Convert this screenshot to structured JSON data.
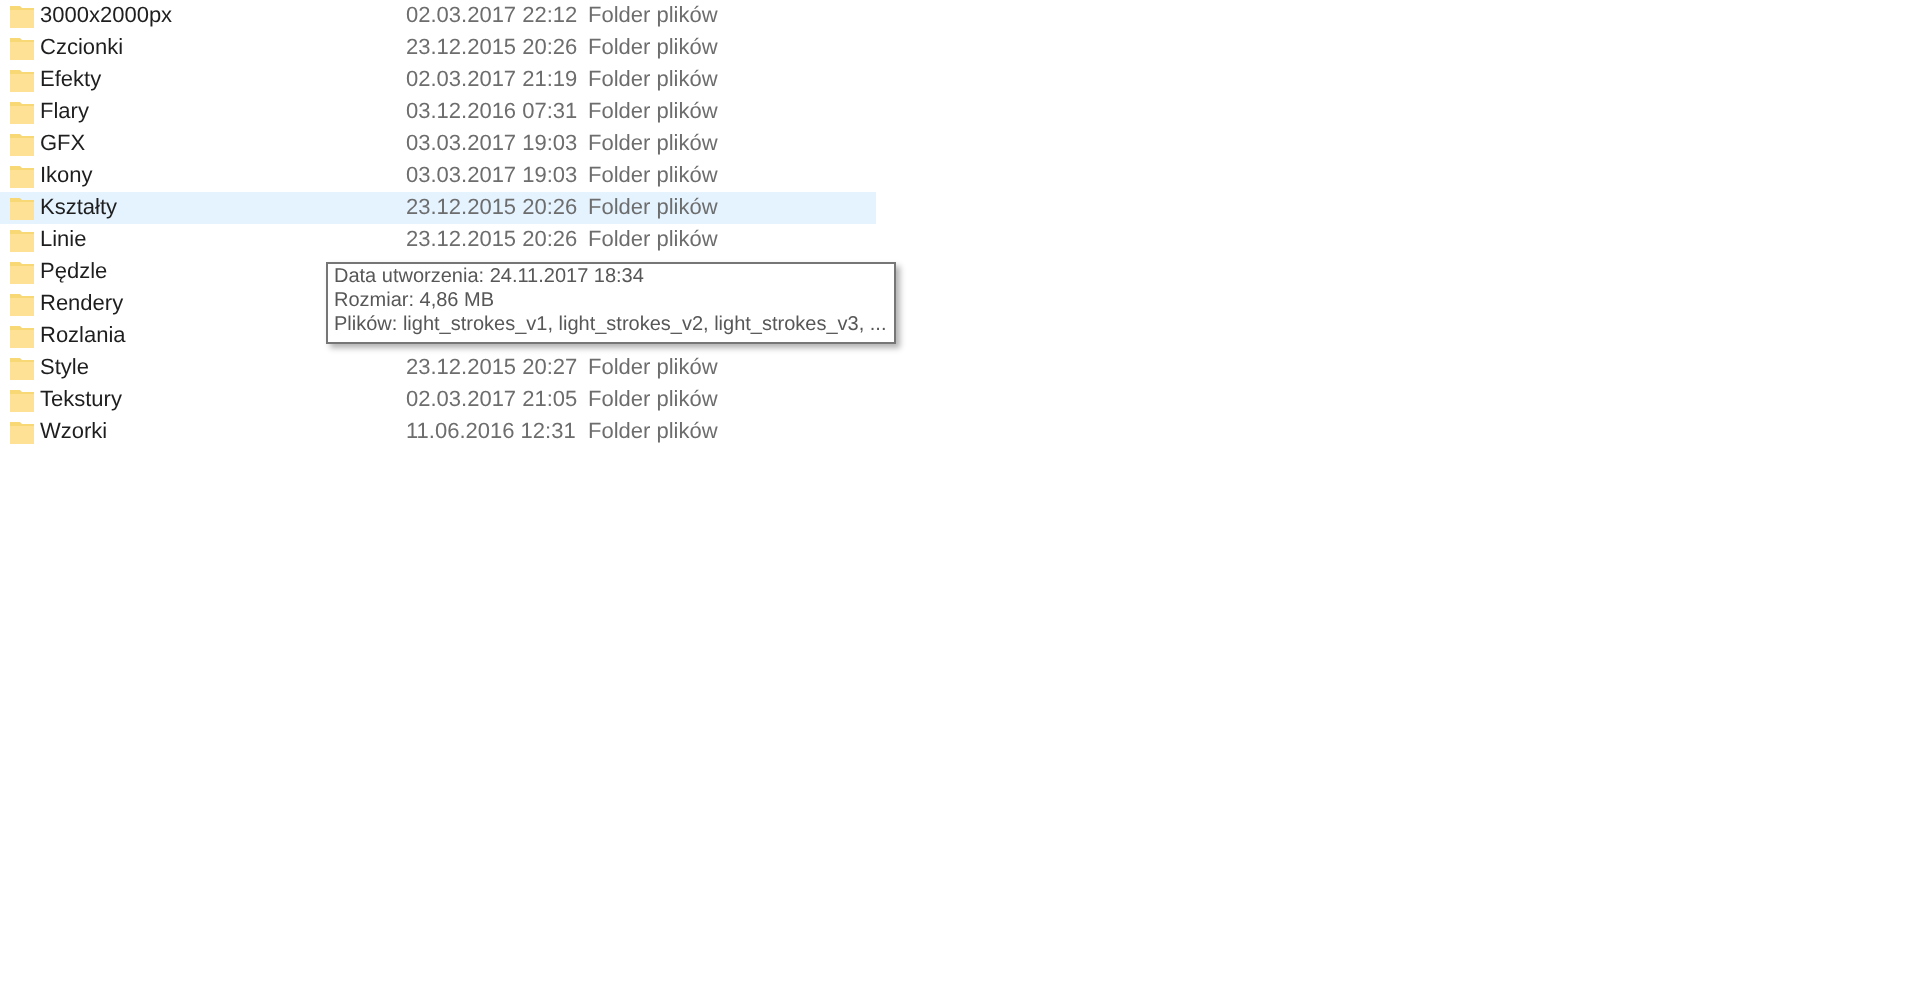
{
  "files": [
    {
      "name": "3000x2000px",
      "modified": "02.03.2017 22:12",
      "type": "Folder plików",
      "selected": false
    },
    {
      "name": "Czcionki",
      "modified": "23.12.2015 20:26",
      "type": "Folder plików",
      "selected": false
    },
    {
      "name": "Efekty",
      "modified": "02.03.2017 21:19",
      "type": "Folder plików",
      "selected": false
    },
    {
      "name": "Flary",
      "modified": "03.12.2016 07:31",
      "type": "Folder plików",
      "selected": false
    },
    {
      "name": "GFX",
      "modified": "03.03.2017 19:03",
      "type": "Folder plików",
      "selected": false
    },
    {
      "name": "Ikony",
      "modified": "03.03.2017 19:03",
      "type": "Folder plików",
      "selected": false
    },
    {
      "name": "Kształty",
      "modified": "23.12.2015 20:26",
      "type": "Folder plików",
      "selected": true
    },
    {
      "name": "Linie",
      "modified": "23.12.2015 20:26",
      "type": "Folder plików",
      "selected": false
    },
    {
      "name": "Pędzle",
      "selected": false
    },
    {
      "name": "Rendery",
      "selected": false
    },
    {
      "name": "Rozlania",
      "selected": false
    },
    {
      "name": "Style",
      "modified": "23.12.2015 20:27",
      "type": "Folder plików",
      "selected": false
    },
    {
      "name": "Tekstury",
      "modified": "02.03.2017 21:05",
      "type": "Folder plików",
      "selected": false
    },
    {
      "name": "Wzorki",
      "modified": "11.06.2016 12:31",
      "type": "Folder plików",
      "selected": false
    }
  ],
  "tooltip": {
    "lines": [
      "Data utworzenia: 24.11.2017 18:34",
      "Rozmiar: 4,86 MB",
      "Plików: light_strokes_v1, light_strokes_v2, light_strokes_v3, ..."
    ]
  }
}
